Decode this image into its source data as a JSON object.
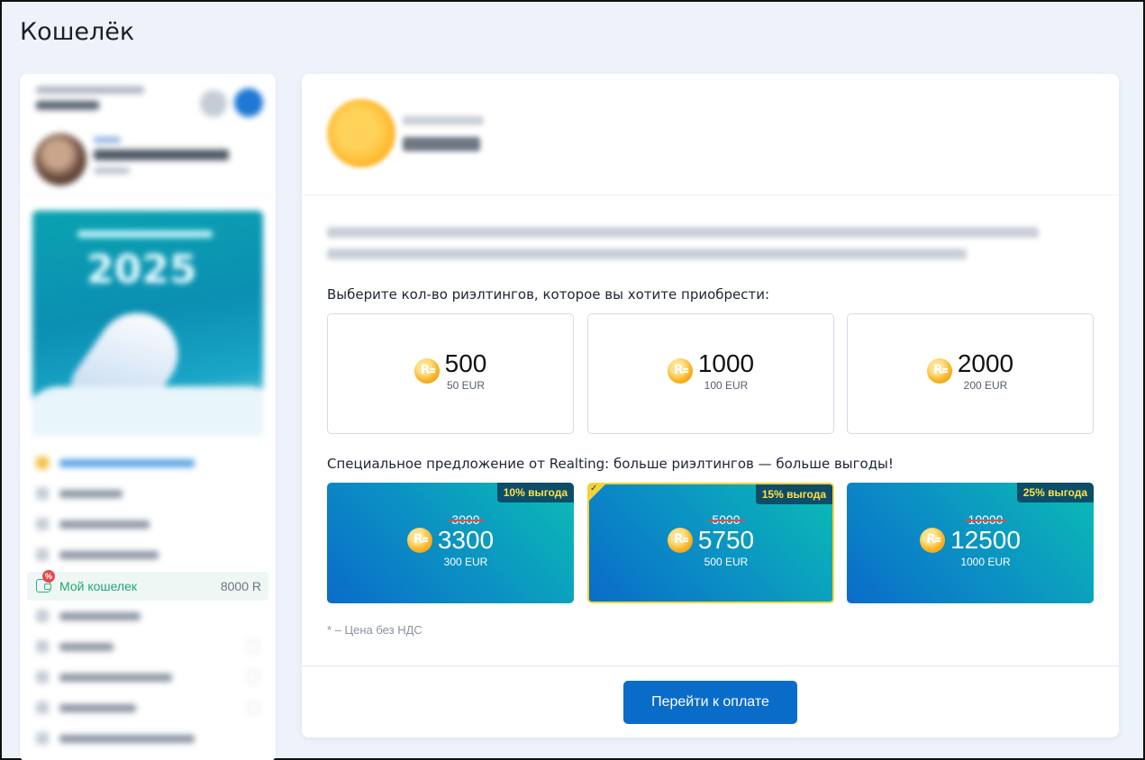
{
  "page": {
    "title": "Кошелёк"
  },
  "sidebar": {
    "wallet": {
      "label": "Мой кошелек",
      "amount": "8000 R",
      "badge": "%"
    }
  },
  "main": {
    "choose_label": "Выберите кол-во риэлтингов, которое вы хотите приобрести:",
    "packages": [
      {
        "amount": "500",
        "price": "50 EUR"
      },
      {
        "amount": "1000",
        "price": "100 EUR"
      },
      {
        "amount": "2000",
        "price": "200 EUR"
      }
    ],
    "offer_label": "Специальное предложение от Realting: больше риэлтингов — больше выгоды!",
    "offers": [
      {
        "tag": "10% выгода",
        "old": "3000",
        "amount": "3300",
        "price": "300 EUR",
        "selected": false
      },
      {
        "tag": "15% выгода",
        "old": "5000",
        "amount": "5750",
        "price": "500 EUR",
        "selected": true
      },
      {
        "tag": "25% выгода",
        "old": "10000",
        "amount": "12500",
        "price": "1000 EUR",
        "selected": false
      }
    ],
    "vat_note": "* – Цена без НДС",
    "pay_button": "Перейти к оплате"
  },
  "colors": {
    "accent": "#0a6cc9",
    "wallet_green": "#22a672",
    "offer_tag_text": "#ffe14a",
    "selected_border": "#f2d33a",
    "coin": "#f9b424"
  },
  "icons": {
    "coin": "realting-coin-icon",
    "wallet": "wallet-icon",
    "discount": "discount-badge-icon",
    "check": "check-icon"
  }
}
